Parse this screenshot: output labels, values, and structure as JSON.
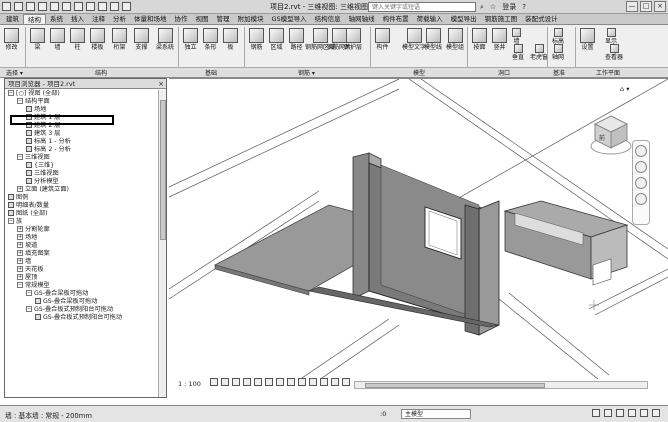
{
  "title": "项目2.rvt - 三维视图: 三维视图",
  "search_placeholder": "键入关键字或短语",
  "title_right": {
    "signin": "登录",
    "help": "?"
  },
  "window_controls": [
    "—",
    "□",
    "×"
  ],
  "menu_tabs": [
    "建筑",
    "结构",
    "系统",
    "插入",
    "注释",
    "分析",
    "体量和场地",
    "协作",
    "视图",
    "管理",
    "附加模块",
    "GS模型导入",
    "结构信息",
    "轴网轴线",
    "构件布置",
    "荷载输入",
    "模型导出",
    "钢筋施工图",
    "装配式设计",
    "修改"
  ],
  "ribbon": {
    "tools": [
      "修改",
      "梁",
      "墙",
      "柱",
      "楼板",
      "桁架",
      "支撑",
      "梁系统",
      "独立",
      "条形",
      "板",
      "钢筋",
      "区域",
      "路径",
      "钢筋网区域",
      "钢筋网片",
      "保护层",
      "构件",
      "模型文字",
      "模型线",
      "模型组",
      "按面",
      "竖井",
      "墙",
      "垂直",
      "老虎窗",
      "标高",
      "轴网",
      "参照平面",
      "设置",
      "显示",
      "查看器"
    ],
    "panels": [
      "选择 ▾",
      "结构",
      "基础",
      "钢筋 ▾",
      "模型",
      "洞口",
      "基准",
      "工作平面"
    ]
  },
  "project_browser": {
    "header": "项目浏览器 - 项目2.rvt",
    "close": "×",
    "items": [
      {
        "indent": 0,
        "exp": "−",
        "label": "[○] 视图 (全部)"
      },
      {
        "indent": 1,
        "exp": "−",
        "label": "结构平面"
      },
      {
        "indent": 2,
        "exp": "",
        "label": "场地"
      },
      {
        "indent": 2,
        "exp": "",
        "label": "建筑 1 层"
      },
      {
        "indent": 2,
        "exp": "",
        "label": "建筑 2 层"
      },
      {
        "indent": 2,
        "exp": "",
        "label": "建筑 3 层"
      },
      {
        "indent": 2,
        "exp": "",
        "label": "标高 1 - 分析"
      },
      {
        "indent": 2,
        "exp": "",
        "label": "标高 2 - 分析"
      },
      {
        "indent": 1,
        "exp": "−",
        "label": "三维视图"
      },
      {
        "indent": 2,
        "exp": "",
        "label": "{三维}"
      },
      {
        "indent": 2,
        "exp": "",
        "label": "三维视图"
      },
      {
        "indent": 2,
        "exp": "",
        "label": "分析模型"
      },
      {
        "indent": 1,
        "exp": "+",
        "label": "立面 (建筑立面)"
      },
      {
        "indent": 0,
        "exp": "",
        "label": "图例"
      },
      {
        "indent": 0,
        "exp": "",
        "label": "明细表/数量"
      },
      {
        "indent": 0,
        "exp": "",
        "label": "图纸 (全部)"
      },
      {
        "indent": 0,
        "exp": "−",
        "label": "族"
      },
      {
        "indent": 1,
        "exp": "+",
        "label": "分割轮廓"
      },
      {
        "indent": 1,
        "exp": "+",
        "label": "场地"
      },
      {
        "indent": 1,
        "exp": "+",
        "label": "坡道"
      },
      {
        "indent": 1,
        "exp": "+",
        "label": "填充图案"
      },
      {
        "indent": 1,
        "exp": "+",
        "label": "墙"
      },
      {
        "indent": 1,
        "exp": "+",
        "label": "天花板"
      },
      {
        "indent": 1,
        "exp": "+",
        "label": "屋顶"
      },
      {
        "indent": 1,
        "exp": "−",
        "label": "常规模型"
      },
      {
        "indent": 2,
        "exp": "−",
        "label": "GS-叠合梁板可拖动"
      },
      {
        "indent": 3,
        "exp": "",
        "label": "GS-叠合梁板可拖动"
      },
      {
        "indent": 2,
        "exp": "−",
        "label": "GS-叠合板式预制阳台可拖动"
      },
      {
        "indent": 3,
        "exp": "",
        "label": "GS-叠合板式预制阳台可拖动"
      }
    ]
  },
  "viewport": {
    "scale": "1 : 100",
    "hud_icons": "⌂ ▾",
    "viewcube_label": "前"
  },
  "status": {
    "text": "墙 : 基本墙 : 常规 - 200mm",
    "num": ":0",
    "model": "主模型"
  }
}
